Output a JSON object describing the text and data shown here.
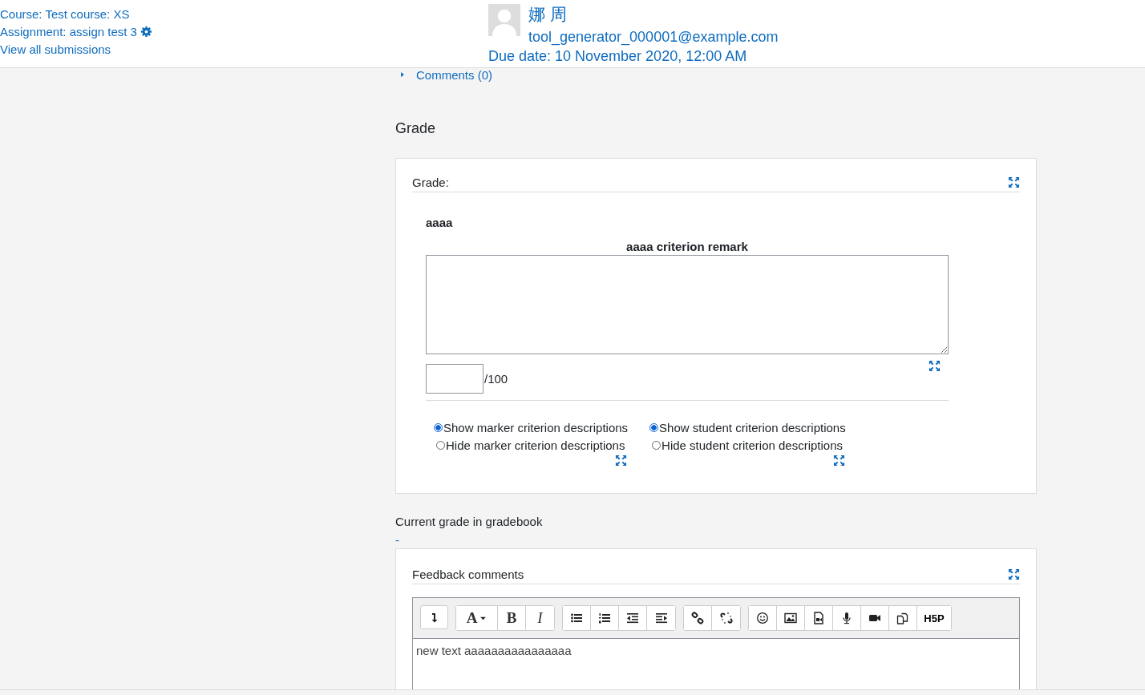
{
  "header": {
    "links": [
      {
        "text": "Course: Test course: XS",
        "gear": false
      },
      {
        "text": "Assignment: assign test 3",
        "gear": true
      },
      {
        "text": "View all submissions",
        "gear": false
      }
    ],
    "user": {
      "name": "娜 周",
      "email": "tool_generator_000001@example.com",
      "due": "Due date: 10 November 2020, 12:00 AM"
    }
  },
  "comments": {
    "label": "Comments (0)",
    "expanded": false
  },
  "grade_heading": "Grade",
  "grade_panel": {
    "label": "Grade:",
    "criterion": "aaaa",
    "remark_label": "aaaa criterion remark",
    "max": "/100",
    "radio_groups": [
      {
        "options": [
          {
            "label": "Show marker criterion descriptions",
            "selected": true
          },
          {
            "label": "Hide marker criterion descriptions",
            "selected": false
          }
        ]
      },
      {
        "options": [
          {
            "label": "Show student criterion descriptions",
            "selected": true
          },
          {
            "label": "Hide student criterion descriptions",
            "selected": false
          }
        ]
      }
    ]
  },
  "current_grade": {
    "label": "Current grade in gradebook",
    "value": "-"
  },
  "feedback": {
    "label": "Feedback comments",
    "text": "new text aaaaaaaaaaaaaaaa",
    "toolbar": [
      [
        {
          "kind": "icon"
        }
      ],
      [
        {
          "kind": "glyph",
          "text": "A"
        },
        {
          "kind": "glyph",
          "text": "B"
        },
        {
          "kind": "glyph",
          "text": "I"
        }
      ],
      [
        {
          "kind": "icon"
        },
        {
          "kind": "icon"
        },
        {
          "kind": "icon"
        },
        {
          "kind": "icon"
        }
      ],
      [
        {
          "kind": "icon"
        },
        {
          "kind": "icon"
        }
      ],
      [
        {
          "kind": "icon"
        },
        {
          "kind": "icon"
        },
        {
          "kind": "icon"
        },
        {
          "kind": "icon"
        },
        {
          "kind": "icon"
        },
        {
          "kind": "icon"
        },
        {
          "kind": "glyph",
          "text": "H5P"
        }
      ]
    ]
  }
}
